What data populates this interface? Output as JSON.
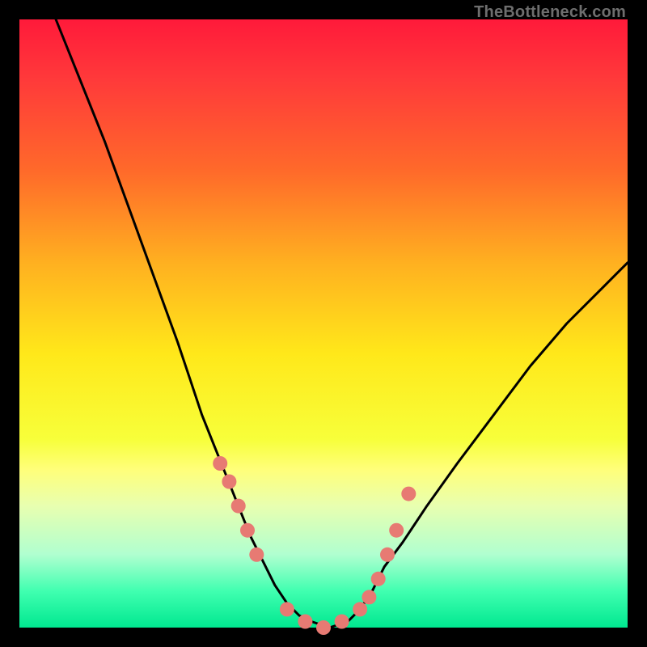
{
  "watermark": "TheBottleneck.com",
  "chart_data": {
    "type": "line",
    "title": "",
    "xlabel": "",
    "ylabel": "",
    "xlim": [
      0,
      100
    ],
    "ylim": [
      0,
      100
    ],
    "grid": false,
    "series": [
      {
        "name": "bottleneck-curve",
        "x": [
          6,
          10,
          14,
          18,
          22,
          26,
          28,
          30,
          32,
          34,
          36,
          38,
          40,
          42,
          44,
          46,
          48,
          51,
          54,
          56,
          58,
          60,
          63,
          67,
          72,
          78,
          84,
          90,
          96,
          100
        ],
        "y": [
          100,
          90,
          80,
          69,
          58,
          47,
          41,
          35,
          30,
          25,
          20,
          15,
          11,
          7,
          4,
          2,
          1,
          0,
          1,
          3,
          6,
          10,
          14,
          20,
          27,
          35,
          43,
          50,
          56,
          60
        ]
      }
    ],
    "markers": {
      "name": "highlight-points",
      "color": "#e77a73",
      "points_x": [
        33,
        34.5,
        36,
        37.5,
        39,
        44,
        47,
        50,
        53,
        56,
        57.5,
        59,
        60.5,
        62,
        64
      ],
      "points_y": [
        27,
        24,
        20,
        16,
        12,
        3,
        1,
        0,
        1,
        3,
        5,
        8,
        12,
        16,
        22
      ]
    }
  }
}
